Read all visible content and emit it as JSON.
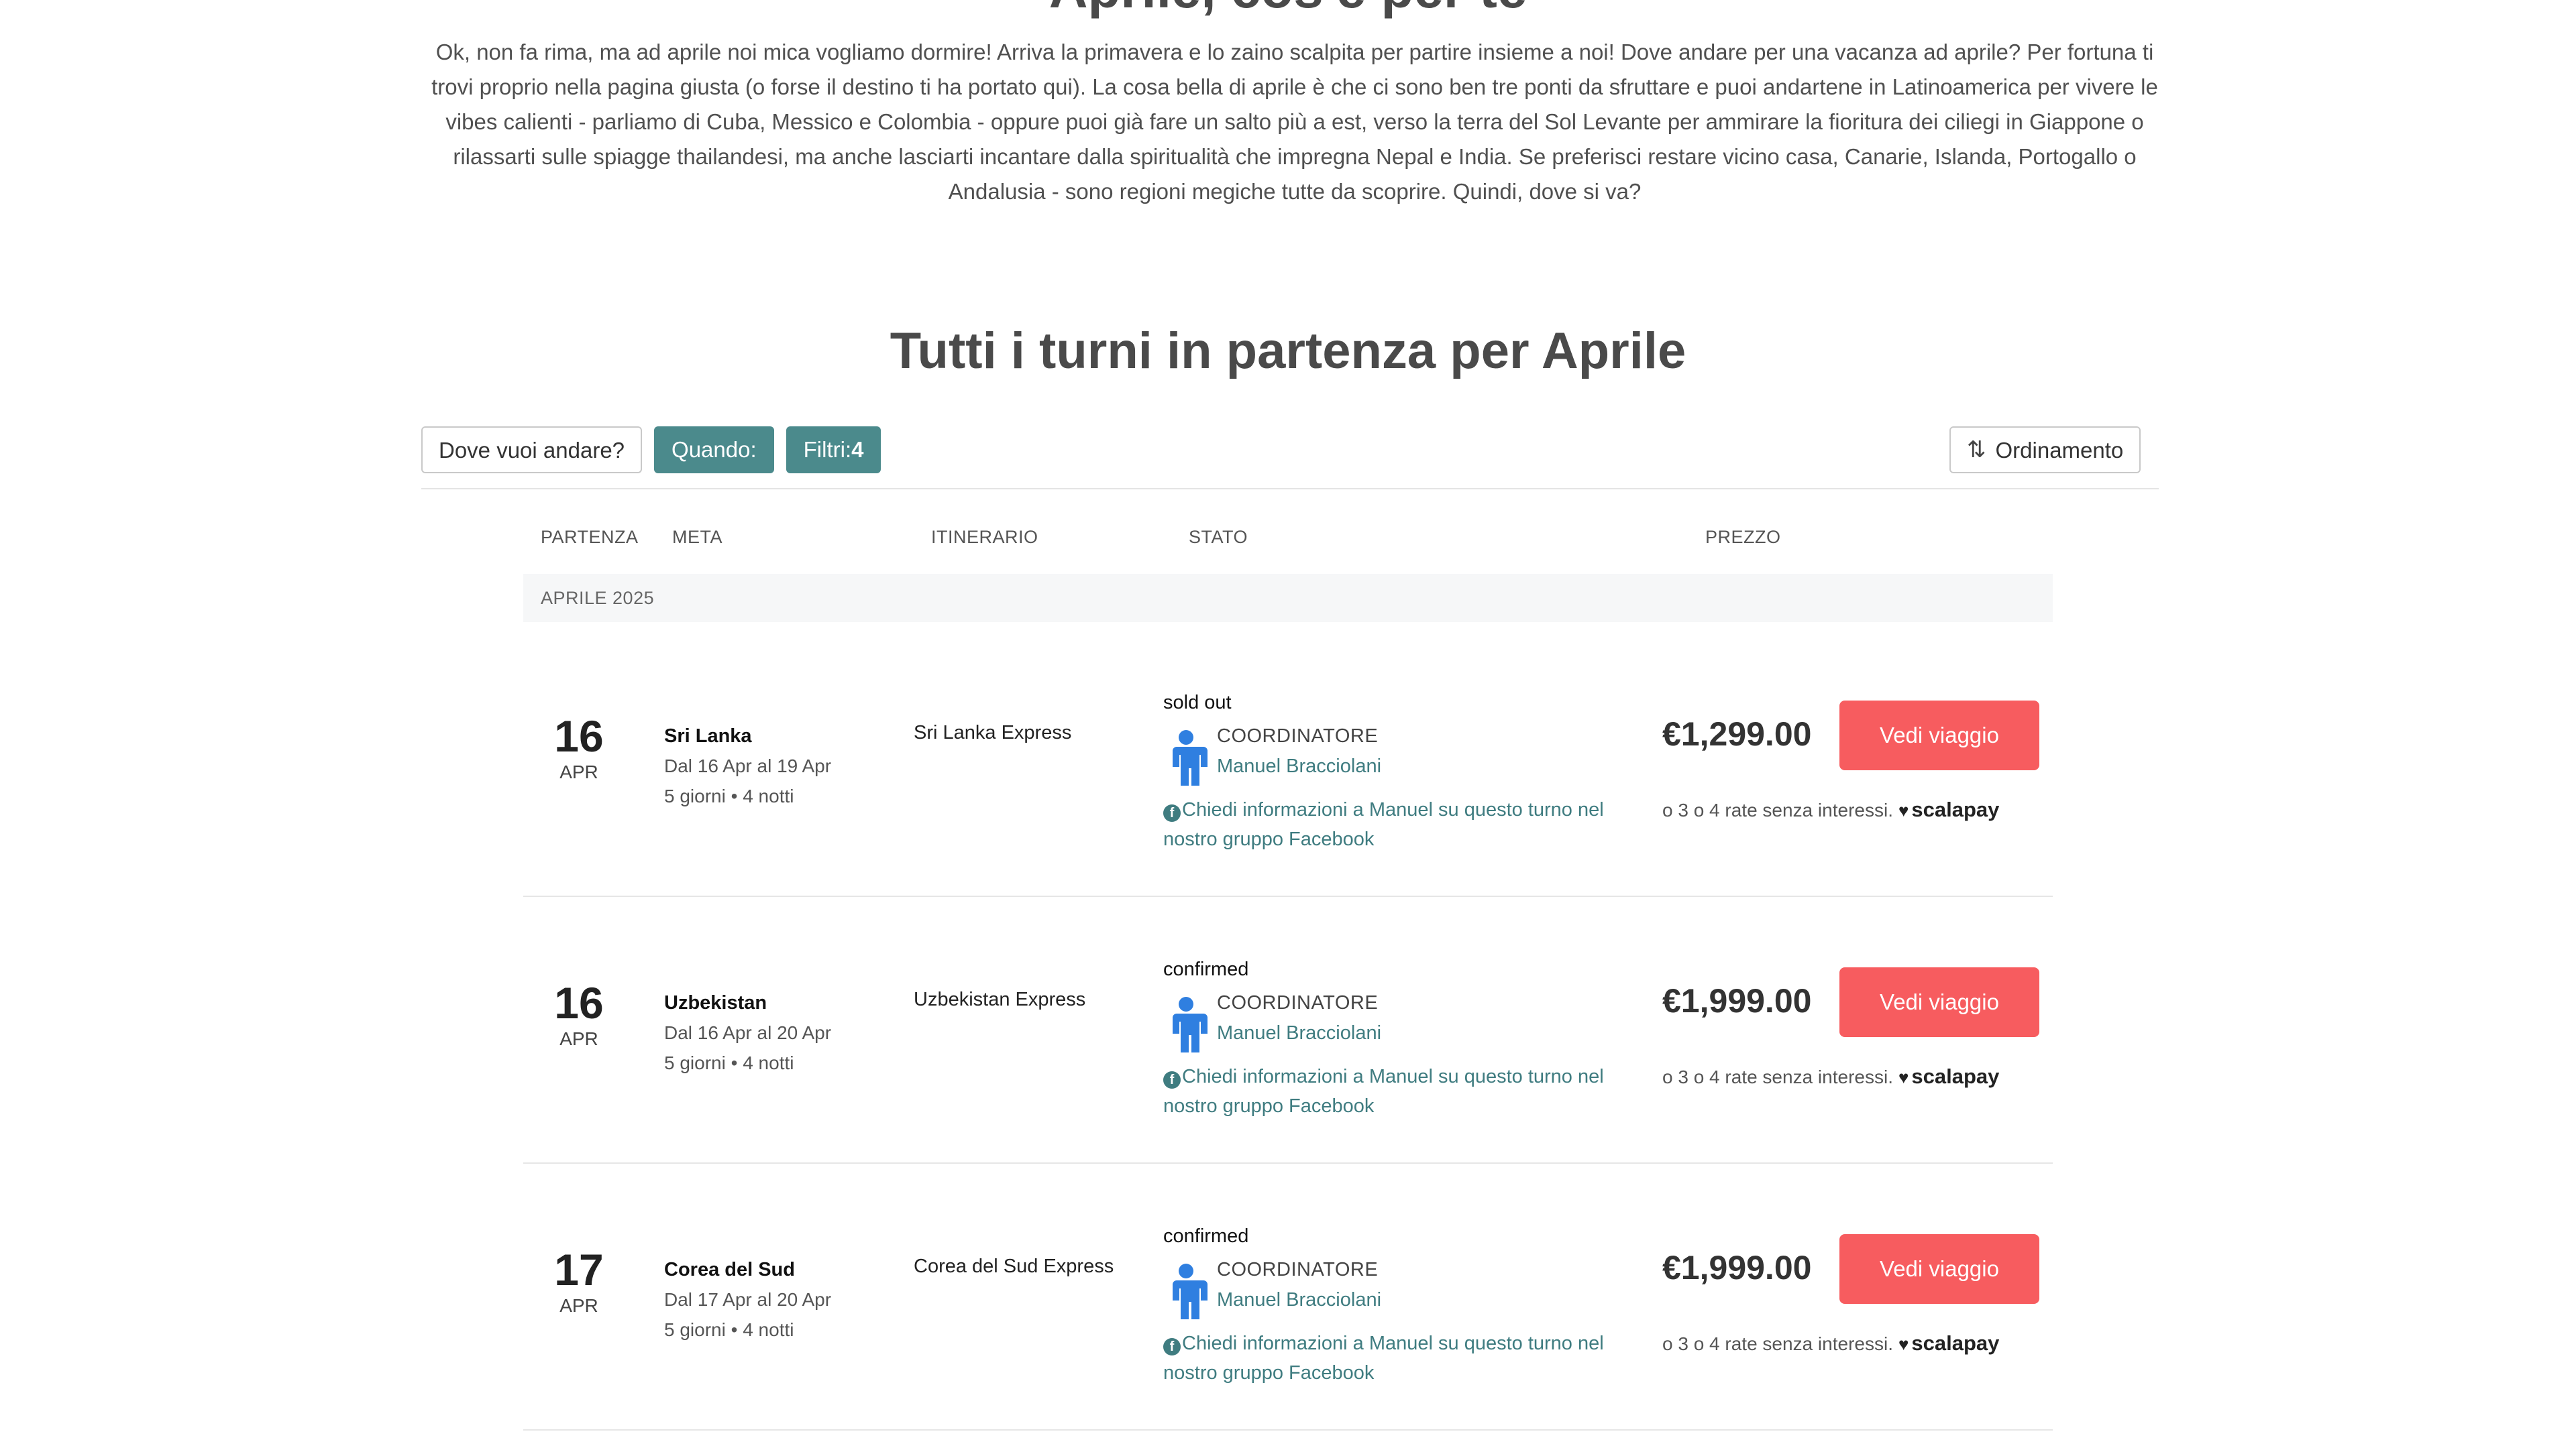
{
  "top_heading": "Aprile, cos'è per te",
  "intro": "Ok, non fa rima, ma ad aprile noi mica vogliamo dormire! Arriva la primavera e lo zaino scalpita per partire insieme a noi! Dove andare per una vacanza ad aprile? Per fortuna ti trovi proprio nella pagina giusta (o forse il destino ti ha portato qui). La cosa bella di aprile è che ci sono ben tre ponti da sfruttare e puoi andartene in Latinoamerica per vivere le vibes calienti - parliamo di Cuba, Messico e Colombia - oppure puoi già fare un salto più a est, verso la terra del Sol Levante per ammirare la fioritura dei ciliegi in Giappone o rilassarti sulle spiagge thailandesi, ma anche lasciarti incantare dalla spiritualità che impregna Nepal e India. Se preferisci restare vicino casa, Canarie, Islanda, Portogallo o Andalusia - sono regioni megiche tutte da scoprire. Quindi, dove si va?",
  "section_title": "Tutti i turni in partenza per Aprile",
  "filters": {
    "destination": "Dove vuoi andare?",
    "when": "Quando:",
    "filters_label": "Filtri:",
    "filters_count": "4",
    "sort": "Ordinamento"
  },
  "columns": {
    "departure": "PARTENZA",
    "destination": "META",
    "itinerary": "ITINERARIO",
    "status": "STATO",
    "price": "PREZZO"
  },
  "month": "APRILE 2025",
  "colors": {
    "teal": "#4b8a8c",
    "cta": "#f75c5f",
    "link": "#3f7c80",
    "coordinator_icon": "#2f7fe0"
  },
  "trips": [
    {
      "day": "16",
      "month": "APR",
      "destination": "Sri Lanka",
      "dates": "Dal 16 Apr al 19 Apr",
      "nights": "5 giorni • 4 notti",
      "itinerary": "Sri Lanka Express",
      "status": "sold out",
      "coordinator_label": "COORDINATORE",
      "coordinator_name": "Manuel Bracciolani",
      "fb_text": "Chiedi informazioni a Manuel su questo turno nel nostro gruppo Facebook",
      "price": "€1,299.00",
      "cta": "Vedi viaggio",
      "installments": "o 3 o 4 rate senza interessi.",
      "pay_brand": "scalapay"
    },
    {
      "day": "16",
      "month": "APR",
      "destination": "Uzbekistan",
      "dates": "Dal 16 Apr al 20 Apr",
      "nights": "5 giorni • 4 notti",
      "itinerary": "Uzbekistan Express",
      "status": "confirmed",
      "coordinator_label": "COORDINATORE",
      "coordinator_name": "Manuel Bracciolani",
      "fb_text": "Chiedi informazioni a Manuel su questo turno nel nostro gruppo Facebook",
      "price": "€1,999.00",
      "cta": "Vedi viaggio",
      "installments": "o 3 o 4 rate senza interessi.",
      "pay_brand": "scalapay"
    },
    {
      "day": "17",
      "month": "APR",
      "destination": "Corea del Sud",
      "dates": "Dal 17 Apr al 20 Apr",
      "nights": "5 giorni • 4 notti",
      "itinerary": "Corea del Sud Express",
      "status": "confirmed",
      "coordinator_label": "COORDINATORE",
      "coordinator_name": "Manuel Bracciolani",
      "fb_text": "Chiedi informazioni a Manuel su questo turno nel nostro gruppo Facebook",
      "price": "€1,999.00",
      "cta": "Vedi viaggio",
      "installments": "o 3 o 4 rate senza interessi.",
      "pay_brand": "scalapay"
    }
  ]
}
